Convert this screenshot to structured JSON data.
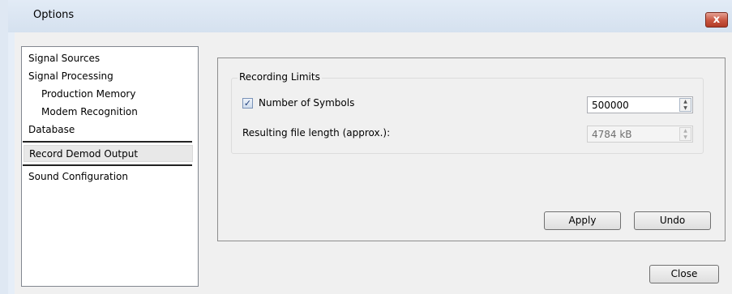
{
  "window": {
    "title": "Options",
    "close_glyph": "x"
  },
  "sidebar": {
    "items": [
      {
        "label": "Signal Sources"
      },
      {
        "label": "Signal Processing"
      },
      {
        "label": "Production Memory"
      },
      {
        "label": "Modem Recognition"
      },
      {
        "label": "Database"
      },
      {
        "label": "Record Demod Output",
        "selected": true
      },
      {
        "label": "Sound Configuration"
      }
    ]
  },
  "recording_limits": {
    "title": "Recording Limits",
    "symbols_label": "Number of Symbols",
    "symbols_checked": true,
    "symbols_value": "500000",
    "file_length_label": "Resulting file length (approx.):",
    "file_length_value": "4784 kB"
  },
  "buttons": {
    "apply": "Apply",
    "undo": "Undo",
    "close": "Close"
  },
  "icons": {
    "check": "✓",
    "spin_up": "▲",
    "spin_down": "▼"
  },
  "colors": {
    "title_bar": "#d5e1ef",
    "close_button": "#c8553f",
    "selection": "#e8e8e8"
  }
}
